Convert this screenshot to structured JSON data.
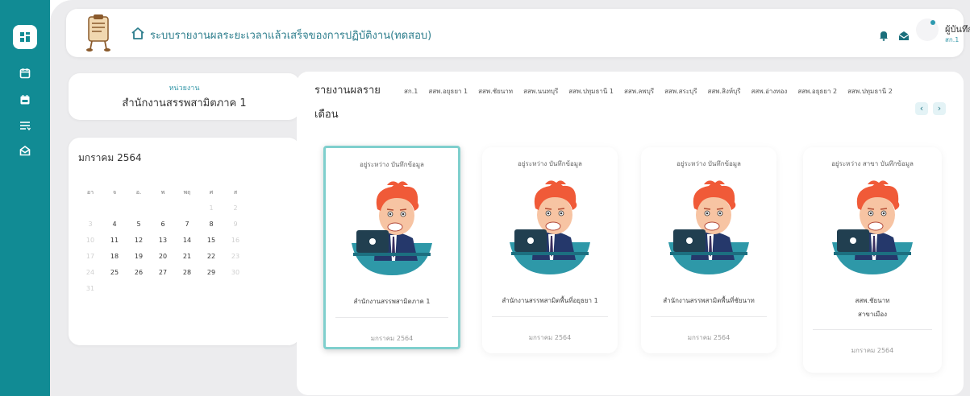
{
  "header": {
    "title": "ระบบรายงานผลระยะเวลาแล้วเสร็จของการปฏิบัติงาน(ทดสอบ)",
    "user_name": "ผู้บันทึก",
    "user_org": "สก.1"
  },
  "sidebar": {
    "items": [
      {
        "icon": "dashboard-icon"
      },
      {
        "icon": "calendar-icon"
      },
      {
        "icon": "calendar-check-icon"
      },
      {
        "icon": "list-icon"
      },
      {
        "icon": "mail-open-icon"
      }
    ]
  },
  "unit": {
    "label": "หน่วยงาน",
    "value": "สำนักงานสรรพสามิตภาค 1"
  },
  "calendar": {
    "month": "มกราคม 2564",
    "weekdays": [
      "อา",
      "จ",
      "อ.",
      "พ",
      "พฤ",
      "ศ",
      "ส"
    ],
    "days": [
      {
        "d": "",
        "m": false
      },
      {
        "d": "",
        "m": false
      },
      {
        "d": "",
        "m": false
      },
      {
        "d": "",
        "m": false
      },
      {
        "d": "",
        "m": false
      },
      {
        "d": "1",
        "m": true
      },
      {
        "d": "2",
        "m": true
      },
      {
        "d": "3",
        "m": true
      },
      {
        "d": "4",
        "m": false
      },
      {
        "d": "5",
        "m": false
      },
      {
        "d": "6",
        "m": false
      },
      {
        "d": "7",
        "m": false
      },
      {
        "d": "8",
        "m": false
      },
      {
        "d": "9",
        "m": true
      },
      {
        "d": "10",
        "m": true
      },
      {
        "d": "11",
        "m": false
      },
      {
        "d": "12",
        "m": false
      },
      {
        "d": "13",
        "m": false
      },
      {
        "d": "14",
        "m": false
      },
      {
        "d": "15",
        "m": false
      },
      {
        "d": "16",
        "m": true
      },
      {
        "d": "17",
        "m": true
      },
      {
        "d": "18",
        "m": false
      },
      {
        "d": "19",
        "m": false
      },
      {
        "d": "20",
        "m": false
      },
      {
        "d": "21",
        "m": false
      },
      {
        "d": "22",
        "m": false
      },
      {
        "d": "23",
        "m": true
      },
      {
        "d": "24",
        "m": true
      },
      {
        "d": "25",
        "m": false
      },
      {
        "d": "26",
        "m": false
      },
      {
        "d": "27",
        "m": false
      },
      {
        "d": "28",
        "m": false
      },
      {
        "d": "29",
        "m": false
      },
      {
        "d": "30",
        "m": true
      },
      {
        "d": "31",
        "m": true
      }
    ]
  },
  "report": {
    "title_line1": "รายงานผลราย",
    "title_line2": "เดือน",
    "org_tabs": [
      "สก.1",
      "สสพ.อยุธยา 1",
      "สสพ.ชัยนาท",
      "สสพ.นนทบุรี",
      "สสพ.ปทุมธานี 1",
      "สสพ.ลพบุรี",
      "สสพ.สระบุรี",
      "สสพ.สิงห์บุรี",
      "สสพ.อ่างทอง",
      "สสพ.อยุธยา 2",
      "สสพ.ปทุมธานี 2"
    ],
    "prev_label": "‹",
    "next_label": "›",
    "cards": [
      {
        "status": "อยู่ระหว่าง บันทึกข้อมูล",
        "org": "สำนักงานสรรพสามิตภาค 1",
        "org2": "",
        "month": "มกราคม 2564",
        "selected": true
      },
      {
        "status": "อยู่ระหว่าง บันทึกข้อมูล",
        "org": "สำนักงานสรรพสามิตพื้นที่อยุธยา 1",
        "org2": "",
        "month": "มกราคม 2564",
        "selected": false
      },
      {
        "status": "อยู่ระหว่าง บันทึกข้อมูล",
        "org": "สำนักงานสรรพสามิตพื้นที่ชัยนาท",
        "org2": "",
        "month": "มกราคม 2564",
        "selected": false
      },
      {
        "status": "อยู่ระหว่าง สาขา บันทึกข้อมูล",
        "org": "สสพ.ชัยนาท",
        "org2": "สาขาเมือง",
        "month": "มกราคม 2564",
        "selected": false
      }
    ]
  },
  "colors": {
    "sidebar": "#118b94",
    "accent": "#2c7d8c",
    "selected_border": "#7fcfcd"
  }
}
